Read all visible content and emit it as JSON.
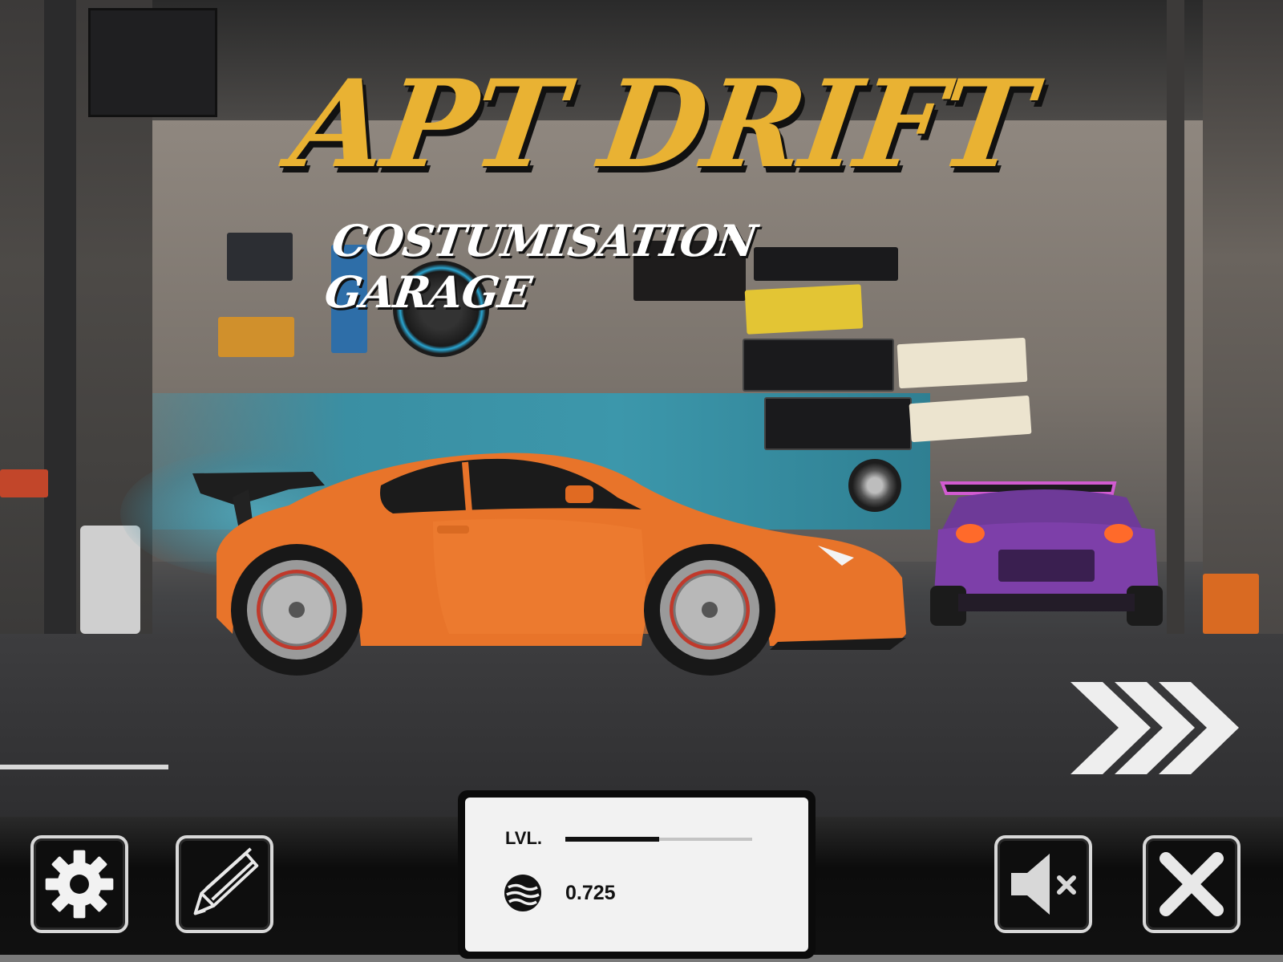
{
  "game": {
    "title": "APT DRIFT",
    "subtitle": "COSTUMISATION GARAGE"
  },
  "stats": {
    "level_label": "LVL.",
    "level_progress": 0.5,
    "coins_value": "0.725"
  },
  "buttons": {
    "settings_icon": "gear-icon",
    "edit_icon": "pencil-icon",
    "mute_icon": "speaker-muted-icon",
    "close_icon": "close-icon",
    "next_icon": "chevrons-right-icon"
  },
  "colors": {
    "title": "#e9b233",
    "car_primary": "#e8742a",
    "car_secondary": "#7a3aa0"
  }
}
